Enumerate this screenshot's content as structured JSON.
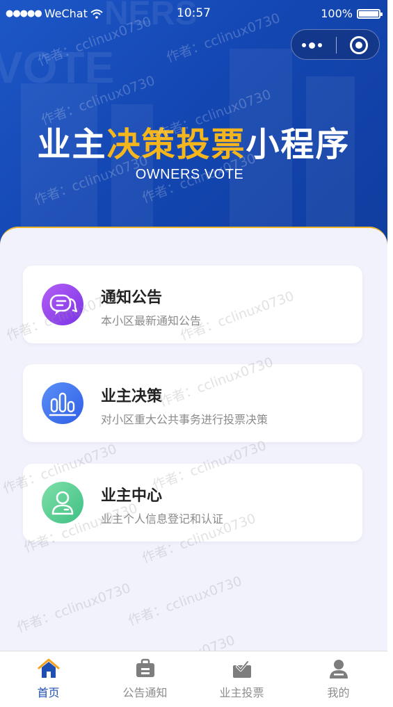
{
  "status_bar": {
    "carrier": "WeChat",
    "time": "10:57",
    "battery": "100%"
  },
  "hero": {
    "title_part1": "业主",
    "title_accent": "决策投票",
    "title_part2": "小程序",
    "subtitle": "OWNERS VOTE"
  },
  "menu": [
    {
      "title": "通知公告",
      "desc": "本小区最新通知公告",
      "icon": "chat-bubbles-icon",
      "icon_color": "#8c3ff0"
    },
    {
      "title": "业主决策",
      "desc": "对小区重大公共事务进行投票决策",
      "icon": "bar-chart-icon",
      "icon_color": "#3a6ff0"
    },
    {
      "title": "业主中心",
      "desc": "业主个人信息登记和认证",
      "icon": "user-icon",
      "icon_color": "#52c98a"
    }
  ],
  "tabbar": [
    {
      "label": "首页",
      "icon": "home-icon",
      "active": true
    },
    {
      "label": "公告通知",
      "icon": "briefcase-icon",
      "active": false
    },
    {
      "label": "业主投票",
      "icon": "vote-box-icon",
      "active": false
    },
    {
      "label": "我的",
      "icon": "profile-icon",
      "active": false
    }
  ],
  "watermark": "作者：cclinux0730",
  "colors": {
    "hero_blue": "#1447b3",
    "accent_yellow": "#f5b51c",
    "active_tab": "#1f4fb2",
    "page_bg": "#f2f2fc"
  }
}
